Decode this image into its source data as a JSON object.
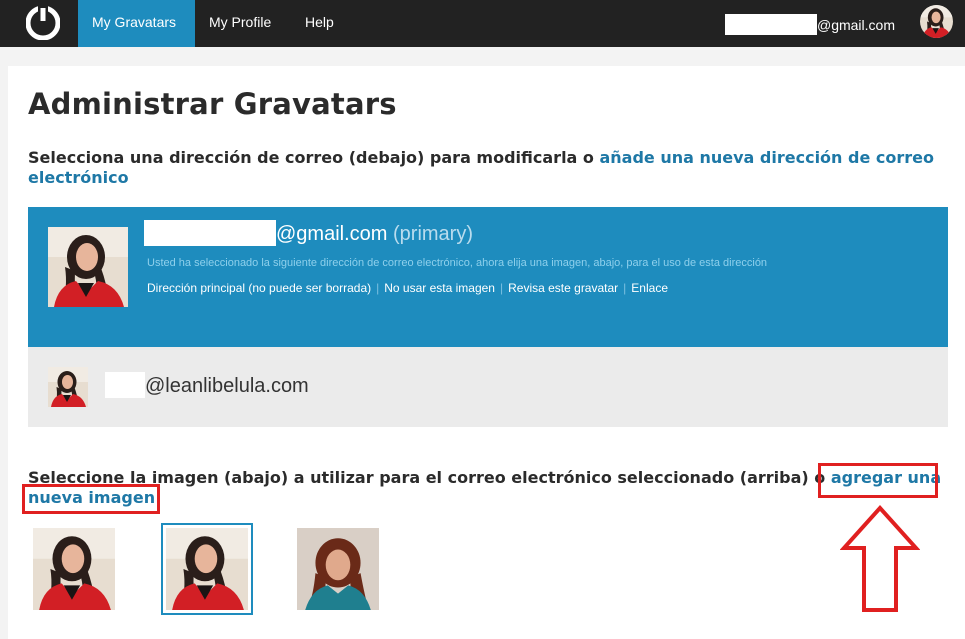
{
  "nav": {
    "items": [
      {
        "label": "My Gravatars",
        "active": true
      },
      {
        "label": "My Profile",
        "active": false
      },
      {
        "label": "Help",
        "active": false
      }
    ],
    "user_email_domain": "@gmail.com",
    "logo_icon": "gravatar-power-icon"
  },
  "page": {
    "title": "Administrar Gravatars",
    "subtitle_text": "Selecciona una dirección de correo (debajo) para modificarla o ",
    "subtitle_link": "añade una nueva dirección de correo electrónico"
  },
  "emails": {
    "primary": {
      "domain": "@gmail.com",
      "tag": "(primary)",
      "description": "Usted ha seleccionado la siguiente dirección de correo electrónico, ahora elija una imagen, abajo, para el uso de esta dirección",
      "actions": [
        "Dirección principal (no puede ser borrada)",
        "No usar esta imagen",
        "Revisa este gravatar",
        "Enlace"
      ]
    },
    "secondary": {
      "domain": "@leanlibelula.com"
    }
  },
  "images": {
    "instruction_text": "Seleccione la imagen (abajo) a utilizar para el correo electrónico seleccionado (arriba) o ",
    "add_link": "agregar una nueva imagen"
  },
  "colors": {
    "nav_bg": "#222222",
    "accent": "#1e8cbe",
    "link": "#1e78a6",
    "highlight_red": "#e02020"
  }
}
